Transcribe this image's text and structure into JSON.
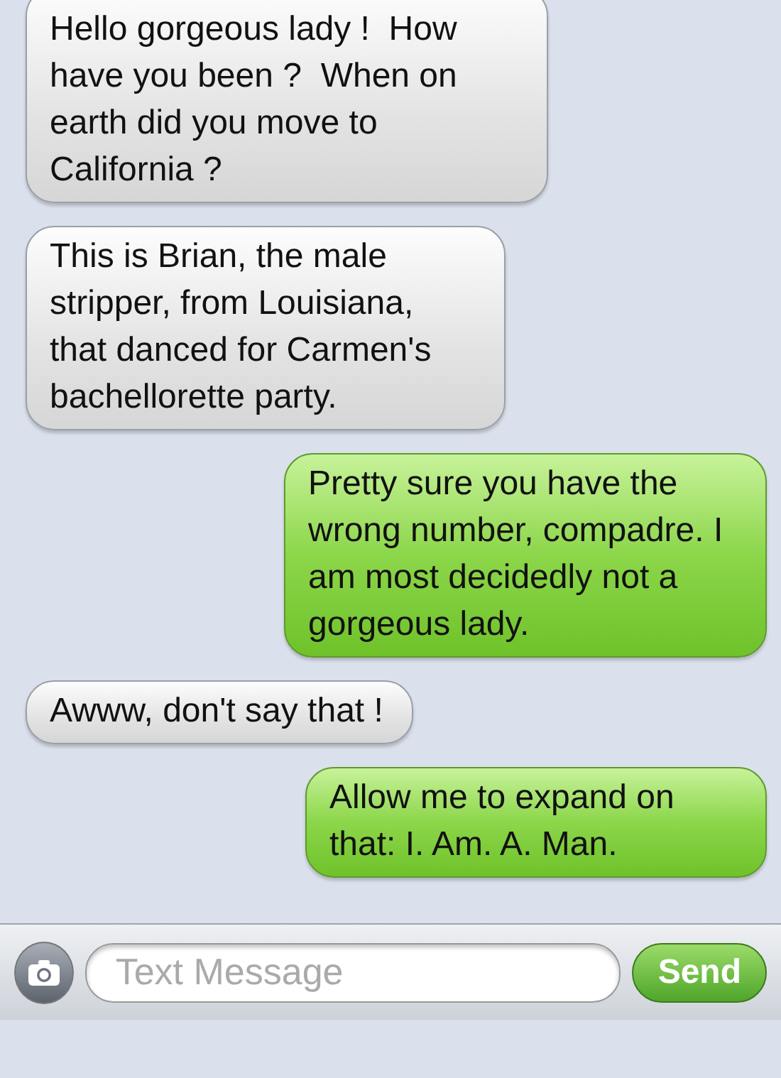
{
  "messages": [
    {
      "kind": "received",
      "text": "Hello gorgeous lady !  How have you been ?  When on earth did you move to California ?"
    },
    {
      "kind": "received",
      "text": "This is Brian, the male stripper, from Louisiana, that danced for Carmen's bachellorette party."
    },
    {
      "kind": "sent",
      "text": "Pretty sure you have the wrong number, compadre. I am most decidedly not a gorgeous lady."
    },
    {
      "kind": "received",
      "text": "Awww, don't say that !"
    },
    {
      "kind": "sent",
      "text": "Allow me to expand on that: I. Am. A. Man."
    }
  ],
  "composer": {
    "placeholder": "Text Message",
    "send": "Send"
  }
}
